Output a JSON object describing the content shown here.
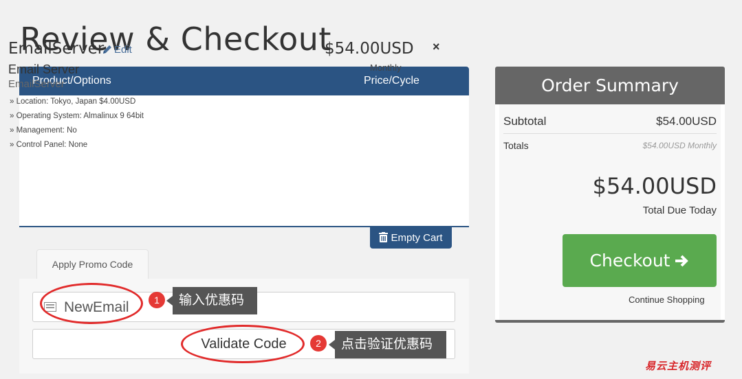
{
  "page": {
    "title": "Review & Checkout"
  },
  "cart": {
    "header": {
      "product": "Product/Options",
      "price": "Price/Cycle"
    },
    "item": {
      "name": "EmailServer",
      "edit_label": "Edit",
      "group": "Email Server",
      "product": "EmailServer",
      "options": [
        "» Location: Tokyo, Japan $4.00USD",
        "» Operating System: Almalinux 9 64bit",
        "» Management: No",
        "» Control Panel: None"
      ],
      "price": "$54.00USD",
      "cycle": "Monthly",
      "remove_symbol": "×"
    },
    "empty_cart_label": "Empty Cart",
    "brand_color": "#2b5483"
  },
  "promo": {
    "tab_label": "Apply Promo Code",
    "code_value": "NewEmail",
    "validate_label": "Validate Code",
    "annotations": [
      {
        "number": "1",
        "text": "输入优惠码"
      },
      {
        "number": "2",
        "text": "点击验证优惠码"
      }
    ]
  },
  "summary": {
    "title": "Order Summary",
    "subtotal_label": "Subtotal",
    "subtotal_value": "$54.00USD",
    "totals_label": "Totals",
    "totals_value": "$54.00USD Monthly",
    "due_amount": "$54.00USD",
    "due_label": "Total Due Today",
    "checkout_label": "Checkout",
    "continue_label": "Continue Shopping",
    "checkout_color": "#5aaa4f"
  },
  "watermark": "易云主机测评",
  "icons": [
    "pencil-icon",
    "close-icon",
    "trash-icon",
    "ticket-icon",
    "arrow-right-icon"
  ]
}
